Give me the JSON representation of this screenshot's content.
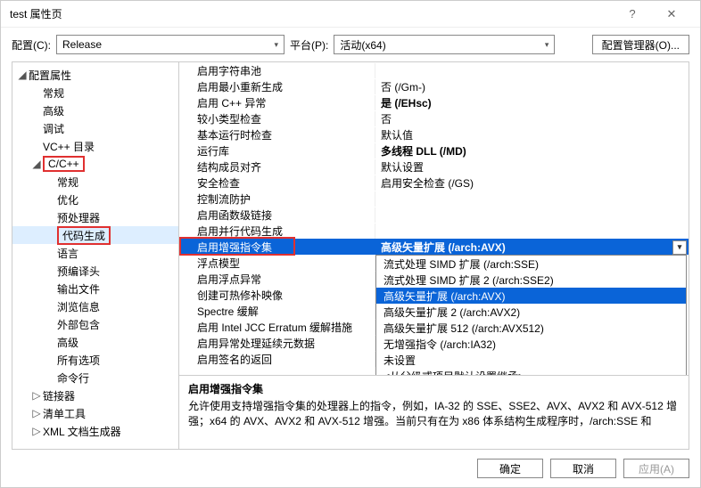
{
  "title": "test 属性页",
  "toolbar": {
    "config_label": "配置(C):",
    "config_value": "Release",
    "platform_label": "平台(P):",
    "platform_value": "活动(x64)",
    "manager_label": "配置管理器(O)..."
  },
  "tree": [
    {
      "label": "配置属性",
      "depth": 0,
      "twist": "◢"
    },
    {
      "label": "常规",
      "depth": 1,
      "twist": ""
    },
    {
      "label": "高级",
      "depth": 1,
      "twist": ""
    },
    {
      "label": "调试",
      "depth": 1,
      "twist": ""
    },
    {
      "label": "VC++ 目录",
      "depth": 1,
      "twist": ""
    },
    {
      "label": "C/C++",
      "depth": 1,
      "twist": "◢",
      "red": true
    },
    {
      "label": "常规",
      "depth": 2,
      "twist": ""
    },
    {
      "label": "优化",
      "depth": 2,
      "twist": ""
    },
    {
      "label": "预处理器",
      "depth": 2,
      "twist": ""
    },
    {
      "label": "代码生成",
      "depth": 2,
      "twist": "",
      "red": true,
      "selected": true
    },
    {
      "label": "语言",
      "depth": 2,
      "twist": ""
    },
    {
      "label": "预编译头",
      "depth": 2,
      "twist": ""
    },
    {
      "label": "输出文件",
      "depth": 2,
      "twist": ""
    },
    {
      "label": "浏览信息",
      "depth": 2,
      "twist": ""
    },
    {
      "label": "外部包含",
      "depth": 2,
      "twist": ""
    },
    {
      "label": "高级",
      "depth": 2,
      "twist": ""
    },
    {
      "label": "所有选项",
      "depth": 2,
      "twist": ""
    },
    {
      "label": "命令行",
      "depth": 2,
      "twist": ""
    },
    {
      "label": "链接器",
      "depth": 1,
      "twist": "▷"
    },
    {
      "label": "清单工具",
      "depth": 1,
      "twist": "▷"
    },
    {
      "label": "XML 文档生成器",
      "depth": 1,
      "twist": "▷"
    }
  ],
  "rows": [
    {
      "label": "启用字符串池",
      "value": ""
    },
    {
      "label": "启用最小重新生成",
      "value": "否 (/Gm-)"
    },
    {
      "label": "启用 C++ 异常",
      "value": "是 (/EHsc)",
      "bold": true
    },
    {
      "label": "较小类型检查",
      "value": "否"
    },
    {
      "label": "基本运行时检查",
      "value": "默认值"
    },
    {
      "label": "运行库",
      "value": "多线程 DLL (/MD)",
      "bold": true
    },
    {
      "label": "结构成员对齐",
      "value": "默认设置"
    },
    {
      "label": "安全检查",
      "value": "启用安全检查 (/GS)"
    },
    {
      "label": "控制流防护",
      "value": ""
    },
    {
      "label": "启用函数级链接",
      "value": ""
    },
    {
      "label": "启用并行代码生成",
      "value": ""
    },
    {
      "label": "启用增强指令集",
      "value": "高级矢量扩展 (/arch:AVX)",
      "selected": true,
      "red": true,
      "bold": true,
      "drop": true
    },
    {
      "label": "浮点模型",
      "value": ""
    },
    {
      "label": "启用浮点异常",
      "value": ""
    },
    {
      "label": "创建可热修补映像",
      "value": ""
    },
    {
      "label": "Spectre 缓解",
      "value": ""
    },
    {
      "label": "启用 Intel JCC Erratum 缓解措施",
      "value": ""
    },
    {
      "label": "启用异常处理延续元数据",
      "value": ""
    },
    {
      "label": "启用签名的返回",
      "value": ""
    }
  ],
  "dropdown": {
    "options": [
      "流式处理 SIMD 扩展 (/arch:SSE)",
      "流式处理 SIMD 扩展 2 (/arch:SSE2)",
      "高级矢量扩展 (/arch:AVX)",
      "高级矢量扩展 2 (/arch:AVX2)",
      "高级矢量扩展 512 (/arch:AVX512)",
      "无增强指令 (/arch:IA32)",
      "未设置",
      "<从父级或项目默认设置继承>"
    ],
    "hl": 2,
    "red": 2
  },
  "desc": {
    "title": "启用增强指令集",
    "text": "允许使用支持增强指令集的处理器上的指令，例如，IA-32 的 SSE、SSE2、AVX、AVX2 和 AVX-512 增强；x64 的 AVX、AVX2 和 AVX-512 增强。当前只有在为 x86 体系结构生成程序时，/arch:SSE 和"
  },
  "footer": {
    "ok": "确定",
    "cancel": "取消",
    "apply": "应用(A)"
  }
}
